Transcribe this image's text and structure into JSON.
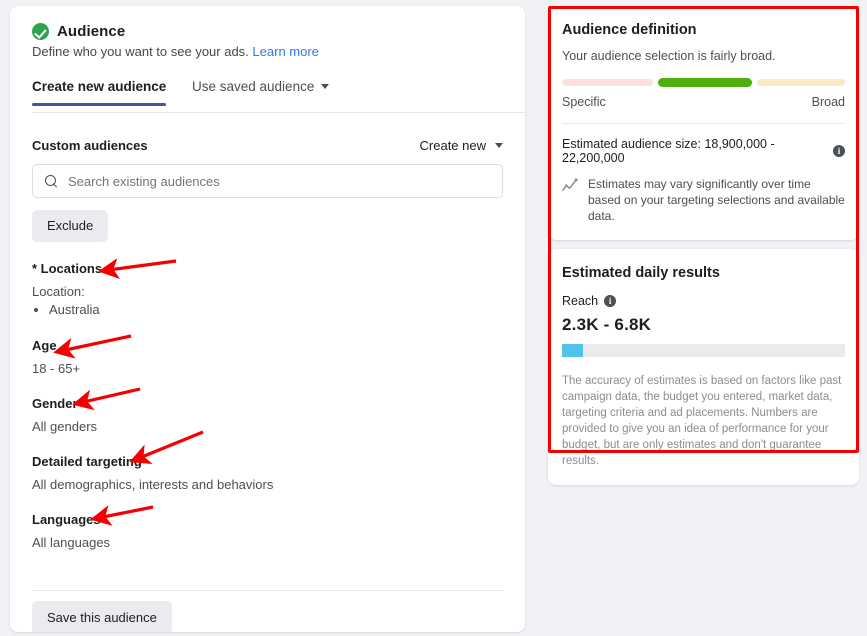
{
  "header": {
    "title": "Audience",
    "subtitle": "Define who you want to see your ads.",
    "learn_more": "Learn more",
    "status_icon": "green-check-icon"
  },
  "tabs": [
    {
      "label": "Create new audience",
      "active": true
    },
    {
      "label": "Use saved audience",
      "active": false
    }
  ],
  "custom_audiences": {
    "label": "Custom audiences",
    "create_new": "Create new",
    "search_placeholder": "Search existing audiences",
    "exclude_label": "Exclude"
  },
  "targeting": {
    "locations": {
      "label": "* Locations",
      "value_label": "Location:",
      "items": [
        "Australia"
      ]
    },
    "age": {
      "label": "Age",
      "value": "18 - 65+"
    },
    "gender": {
      "label": "Gender",
      "value": "All genders"
    },
    "detailed": {
      "label": "Detailed targeting",
      "value": "All demographics, interests and behaviors"
    },
    "languages": {
      "label": "Languages",
      "value": "All languages"
    }
  },
  "save_button": "Save this audience",
  "audience_definition": {
    "title": "Audience definition",
    "subtitle": "Your audience selection is fairly broad.",
    "gauge": {
      "left_label": "Specific",
      "right_label": "Broad",
      "segments": [
        "#fbe0dc",
        "#4caf0e",
        "#fbeac4"
      ],
      "active_index": 1
    },
    "estimated_size_label": "Estimated audience size: 18,900,000 - 22,200,000",
    "note": "Estimates may vary significantly over time based on your targeting selections and available data."
  },
  "daily_results": {
    "title": "Estimated daily results",
    "reach_label": "Reach",
    "reach_value": "2.3K - 6.8K",
    "reach_fill_percent": 7.5,
    "disclaimer": "The accuracy of estimates is based on factors like past campaign data, the budget you entered, market data, targeting criteria and ad placements. Numbers are provided to give you an idea of performance for your budget, but are only estimates and don't guarantee results."
  },
  "annotations": {
    "highlight_color": "#f40000",
    "arrow_count": 5
  }
}
